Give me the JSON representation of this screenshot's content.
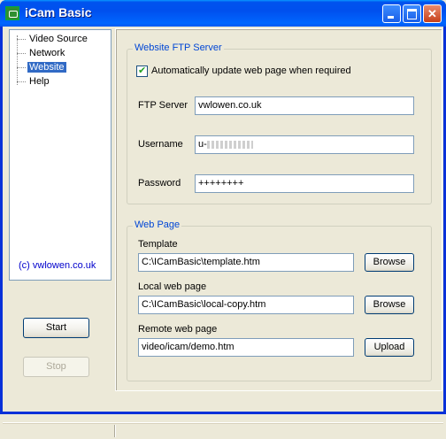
{
  "window": {
    "title": "iCam Basic"
  },
  "tree": {
    "items": [
      {
        "label": "Video Source",
        "selected": false
      },
      {
        "label": "Network",
        "selected": false
      },
      {
        "label": "Website",
        "selected": true
      },
      {
        "label": "Help",
        "selected": false
      }
    ],
    "copyright": "(c) vwlowen.co.uk"
  },
  "buttons": {
    "start": "Start",
    "stop": "Stop"
  },
  "ftp": {
    "group_title": "Website FTP Server",
    "auto_update_label": "Automatically update web page when required",
    "auto_update_checked": true,
    "server_label": "FTP Server",
    "server_value": "vwlowen.co.uk",
    "username_label": "Username",
    "username_value": "u-",
    "password_label": "Password",
    "password_value": "++++++++"
  },
  "webpage": {
    "group_title": "Web Page",
    "template_label": "Template",
    "template_value": "C:\\ICamBasic\\template.htm",
    "template_button": "Browse",
    "local_label": "Local web page",
    "local_value": "C:\\ICamBasic\\local-copy.htm",
    "local_button": "Browse",
    "remote_label": "Remote web page",
    "remote_value": "video/icam/demo.htm",
    "remote_button": "Upload"
  }
}
